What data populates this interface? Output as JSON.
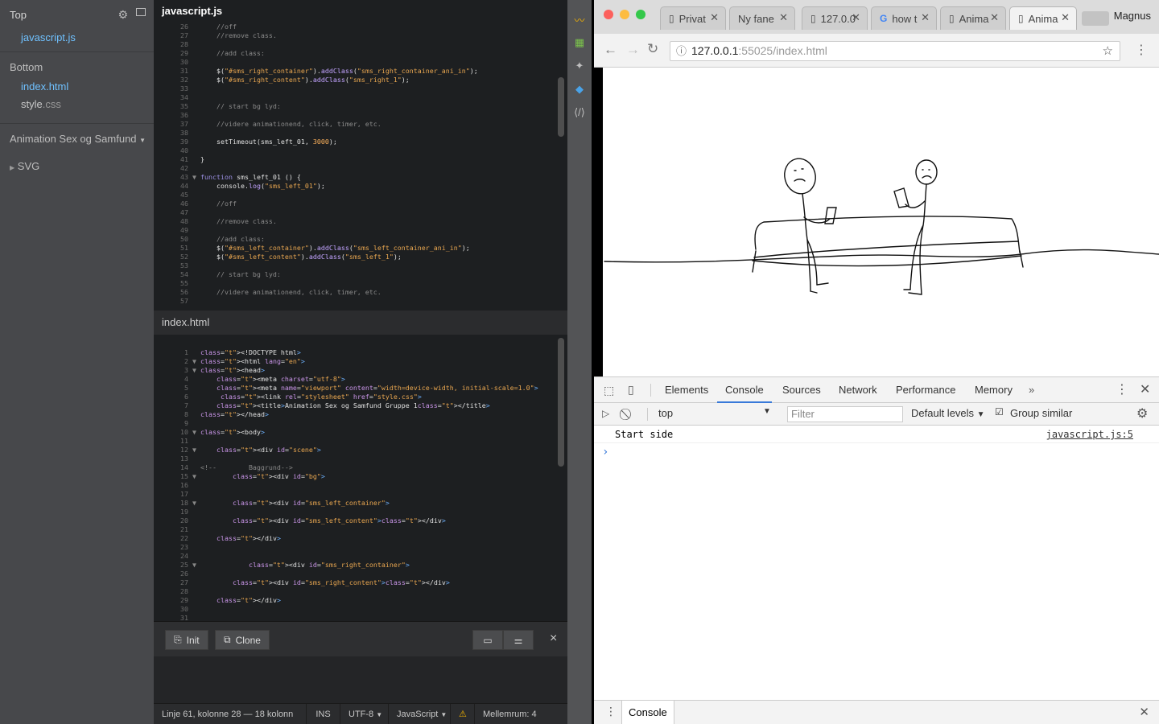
{
  "sidebar": {
    "top_label": "Top",
    "top_files": [
      "javascript.js"
    ],
    "bottom_label": "Bottom",
    "bottom_files": [
      {
        "name": "index.html"
      },
      {
        "name": "style",
        "ext": ".css"
      }
    ],
    "project": "Animation Sex og Samfund",
    "folders": [
      "SVG"
    ]
  },
  "editor_top": {
    "filename": "javascript.js",
    "lines": [
      {
        "n": "26",
        "t": "    //off",
        "fold": ""
      },
      {
        "n": "27",
        "t": "    //remove class.",
        "fold": ""
      },
      {
        "n": "28",
        "t": "",
        "fold": ""
      },
      {
        "n": "29",
        "t": "    //add class:",
        "fold": ""
      },
      {
        "n": "30",
        "t": "",
        "fold": ""
      },
      {
        "n": "31",
        "t": "    $(\"#sms_right_container\").addClass(\"sms_right_container_ani_in\");",
        "fold": ""
      },
      {
        "n": "32",
        "t": "    $(\"#sms_right_content\").addClass(\"sms_right_1\");",
        "fold": ""
      },
      {
        "n": "33",
        "t": "",
        "fold": ""
      },
      {
        "n": "34",
        "t": "",
        "fold": ""
      },
      {
        "n": "35",
        "t": "    // start bg lyd:",
        "fold": ""
      },
      {
        "n": "36",
        "t": "",
        "fold": ""
      },
      {
        "n": "37",
        "t": "    //videre animationend, click, timer, etc.",
        "fold": ""
      },
      {
        "n": "38",
        "t": "",
        "fold": ""
      },
      {
        "n": "39",
        "t": "    setTimeout(sms_left_01, 3000);",
        "fold": ""
      },
      {
        "n": "40",
        "t": "",
        "fold": ""
      },
      {
        "n": "41",
        "t": "}",
        "fold": ""
      },
      {
        "n": "42",
        "t": "",
        "fold": ""
      },
      {
        "n": "43",
        "t": "function sms_left_01 () {",
        "fold": "▼"
      },
      {
        "n": "44",
        "t": "    console.log(\"sms_left_01\");",
        "fold": ""
      },
      {
        "n": "45",
        "t": "",
        "fold": ""
      },
      {
        "n": "46",
        "t": "    //off",
        "fold": ""
      },
      {
        "n": "47",
        "t": "",
        "fold": ""
      },
      {
        "n": "48",
        "t": "    //remove class.",
        "fold": ""
      },
      {
        "n": "49",
        "t": "",
        "fold": ""
      },
      {
        "n": "50",
        "t": "    //add class:",
        "fold": ""
      },
      {
        "n": "51",
        "t": "    $(\"#sms_left_container\").addClass(\"sms_left_container_ani_in\");",
        "fold": ""
      },
      {
        "n": "52",
        "t": "    $(\"#sms_left_content\").addClass(\"sms_left_1\");",
        "fold": ""
      },
      {
        "n": "53",
        "t": "",
        "fold": ""
      },
      {
        "n": "54",
        "t": "    // start bg lyd:",
        "fold": ""
      },
      {
        "n": "55",
        "t": "",
        "fold": ""
      },
      {
        "n": "56",
        "t": "    //videre animationend, click, timer, etc.",
        "fold": ""
      },
      {
        "n": "57",
        "t": "",
        "fold": ""
      }
    ]
  },
  "editor_bottom": {
    "filename": "index.html",
    "lines": [
      {
        "n": "1",
        "t": "<!DOCTYPE html>",
        "fold": ""
      },
      {
        "n": "2",
        "t": "<html lang=\"en\">",
        "fold": "▼"
      },
      {
        "n": "3",
        "t": "<head>",
        "fold": "▼"
      },
      {
        "n": "4",
        "t": "    <meta charset=\"utf-8\">",
        "fold": ""
      },
      {
        "n": "5",
        "t": "    <meta name=\"viewport\" content=\"width=device-width, initial-scale=1.0\">",
        "fold": ""
      },
      {
        "n": "6",
        "t": "     <link rel=\"stylesheet\" href=\"style.css\">",
        "fold": ""
      },
      {
        "n": "7",
        "t": "    <title>Animation Sex og Samfund Gruppe 1</title>",
        "fold": ""
      },
      {
        "n": "8",
        "t": "</head>",
        "fold": ""
      },
      {
        "n": "9",
        "t": "",
        "fold": ""
      },
      {
        "n": "10",
        "t": "<body>",
        "fold": "▼"
      },
      {
        "n": "11",
        "t": "",
        "fold": ""
      },
      {
        "n": "12",
        "t": "    <div id=\"scene\">",
        "fold": "▼"
      },
      {
        "n": "13",
        "t": "",
        "fold": ""
      },
      {
        "n": "14",
        "t": "<!--        Baggrund-->",
        "fold": ""
      },
      {
        "n": "15",
        "t": "        <div id=\"bg\">",
        "fold": "▼"
      },
      {
        "n": "16",
        "t": "",
        "fold": ""
      },
      {
        "n": "17",
        "t": "",
        "fold": ""
      },
      {
        "n": "18",
        "t": "        <div id=\"sms_left_container\">",
        "fold": "▼"
      },
      {
        "n": "19",
        "t": "",
        "fold": ""
      },
      {
        "n": "20",
        "t": "        <div id=\"sms_left_content\"></div>",
        "fold": ""
      },
      {
        "n": "21",
        "t": "",
        "fold": ""
      },
      {
        "n": "22",
        "t": "    </div>",
        "fold": ""
      },
      {
        "n": "23",
        "t": "",
        "fold": ""
      },
      {
        "n": "24",
        "t": "",
        "fold": ""
      },
      {
        "n": "25",
        "t": "            <div id=\"sms_right_container\">",
        "fold": "▼"
      },
      {
        "n": "26",
        "t": "",
        "fold": ""
      },
      {
        "n": "27",
        "t": "        <div id=\"sms_right_content\"></div>",
        "fold": ""
      },
      {
        "n": "28",
        "t": "",
        "fold": ""
      },
      {
        "n": "29",
        "t": "    </div>",
        "fold": ""
      },
      {
        "n": "30",
        "t": "",
        "fold": ""
      },
      {
        "n": "31",
        "t": "",
        "fold": ""
      }
    ]
  },
  "panel": {
    "init_label": "Init",
    "clone_label": "Clone",
    "close": "×"
  },
  "status": {
    "position": "Linje 61, kolonne 28 — 18 kolonn",
    "mode": "INS",
    "encoding": "UTF-8",
    "language": "JavaScript",
    "spacing": "Mellemrum:  4"
  },
  "browser": {
    "tabs": [
      {
        "title": "Privat",
        "icon": "page-icon"
      },
      {
        "title": "Ny fane",
        "icon": ""
      },
      {
        "title": "127.0.0",
        "icon": "page-icon"
      },
      {
        "title": "how t",
        "icon": "google-icon"
      },
      {
        "title": "Anima",
        "icon": "page-icon"
      },
      {
        "title": "Anima",
        "icon": "page-icon",
        "active": true
      }
    ],
    "profile": "Magnus",
    "url_host": "127.0.0.1",
    "url_rest": ":55025/index.html"
  },
  "devtools": {
    "tabs": [
      "Elements",
      "Console",
      "Sources",
      "Network",
      "Performance",
      "Memory"
    ],
    "active_tab": "Console",
    "context": "top",
    "filter_placeholder": "Filter",
    "levels": "Default levels",
    "group_similar": "Group similar",
    "messages": [
      {
        "text": "Start side",
        "source": "javascript.js:5"
      }
    ],
    "prompt": "›",
    "drawer_tab": "Console"
  },
  "colors": {
    "accent": "#3879d9",
    "editor_bg": "#1d1f21",
    "sidebar_bg": "#47484b"
  }
}
